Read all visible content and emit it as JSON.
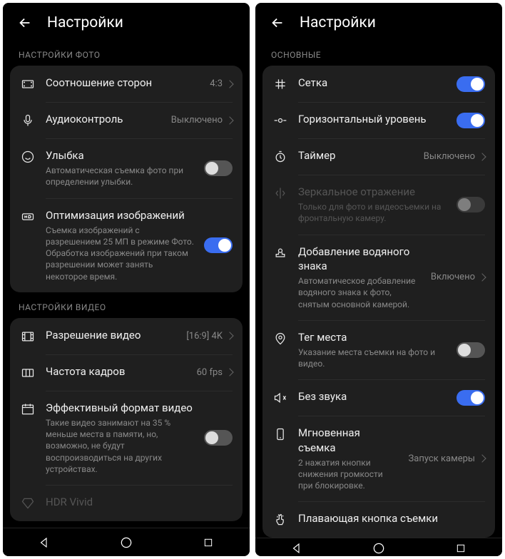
{
  "left": {
    "title": "Настройки",
    "section_photo": "НАСТРОЙКИ ФОТО",
    "aspect": {
      "label": "Соотношение сторон",
      "value": "4:3"
    },
    "audio": {
      "label": "Аудиоконтроль",
      "value": "Выключено"
    },
    "smile": {
      "label": "Улыбка",
      "desc": "Автоматическая съемка фото при определении улыбки."
    },
    "hd": {
      "label": "Оптимизация изображений",
      "desc": "Съемка изображений с разрешением 25 МП в режиме Фото. Обработка изображений при таком разрешении может занять некоторое время."
    },
    "section_video": "НАСТРОЙКИ ВИДЕО",
    "vres": {
      "label": "Разрешение видео",
      "value": "[16:9] 4K"
    },
    "fps": {
      "label": "Частота кадров",
      "value": "60 fps"
    },
    "eff": {
      "label": "Эффективный формат видео",
      "desc": "Такие видео занимают на 35 % меньше места в памяти, но, возможно, не будут воспроизводиться на других устройствах."
    },
    "hdr": {
      "label": "HDR Vivid"
    }
  },
  "right": {
    "title": "Настройки",
    "section_main": "ОСНОВНЫЕ",
    "grid": {
      "label": "Сетка"
    },
    "level": {
      "label": "Горизонтальный уровень"
    },
    "timer": {
      "label": "Таймер",
      "value": "Выключено"
    },
    "mirror": {
      "label": "Зеркальное отражение",
      "desc": "Только для фото и видеосъемки на фронтальную камеру."
    },
    "water": {
      "label": "Добавление водяного знака",
      "desc": "Автоматическое добавление водяного знака к фото, снятым основной камерой.",
      "value": "Включено"
    },
    "geo": {
      "label": "Тег места",
      "desc": "Указание места съемки на фото и видео."
    },
    "mute": {
      "label": "Без звука"
    },
    "quick": {
      "label": "Мгновенная съемка",
      "desc": "2 нажатия кнопки снижения громкости при блокировке.",
      "value": "Запуск камеры"
    },
    "float": {
      "label": "Плавающая кнопка съемки"
    }
  }
}
